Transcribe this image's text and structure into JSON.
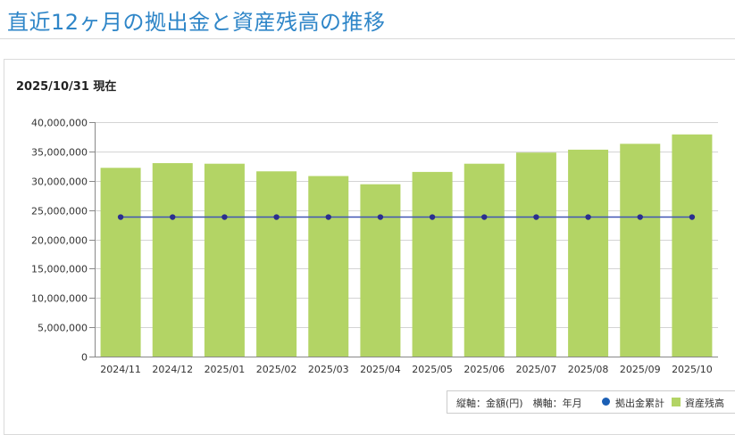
{
  "page_title": "直近12ヶ月の拠出金と資産残高の推移",
  "as_of": "2025/10/31 現在",
  "legend": {
    "axis_note": "縦軸：金額(円)　横軸：年月",
    "contributions_label": "拠出金累計",
    "balance_label": "資産残高"
  },
  "colors": {
    "title": "#2f86c8",
    "bar": "#b3d465",
    "line": "#4055b5",
    "marker": "#2b2f8f",
    "legend_dot": "#1b5fb5",
    "grid": "#d4d4d4"
  },
  "chart_data": {
    "type": "bar",
    "title": "",
    "xlabel": "",
    "ylabel": "",
    "ylim": [
      0,
      40000000
    ],
    "yticks": [
      0,
      5000000,
      10000000,
      15000000,
      20000000,
      25000000,
      30000000,
      35000000,
      40000000
    ],
    "ytick_labels": [
      "0",
      "5,000,000",
      "10,000,000",
      "15,000,000",
      "20,000,000",
      "25,000,000",
      "30,000,000",
      "35,000,000",
      "40,000,000"
    ],
    "grid": true,
    "legend_position": "bottom-right",
    "categories": [
      "2024/11",
      "2024/12",
      "2025/01",
      "2025/02",
      "2025/03",
      "2025/04",
      "2025/05",
      "2025/06",
      "2025/07",
      "2025/08",
      "2025/09",
      "2025/10"
    ],
    "series": [
      {
        "name": "資産残高",
        "type": "bar",
        "values": [
          32200000,
          33000000,
          32900000,
          31600000,
          30800000,
          29400000,
          31500000,
          32900000,
          34800000,
          35300000,
          36300000,
          37900000
        ]
      },
      {
        "name": "拠出金累計",
        "type": "line",
        "values": [
          23800000,
          23800000,
          23800000,
          23800000,
          23800000,
          23800000,
          23800000,
          23800000,
          23800000,
          23800000,
          23800000,
          23800000
        ]
      }
    ]
  }
}
